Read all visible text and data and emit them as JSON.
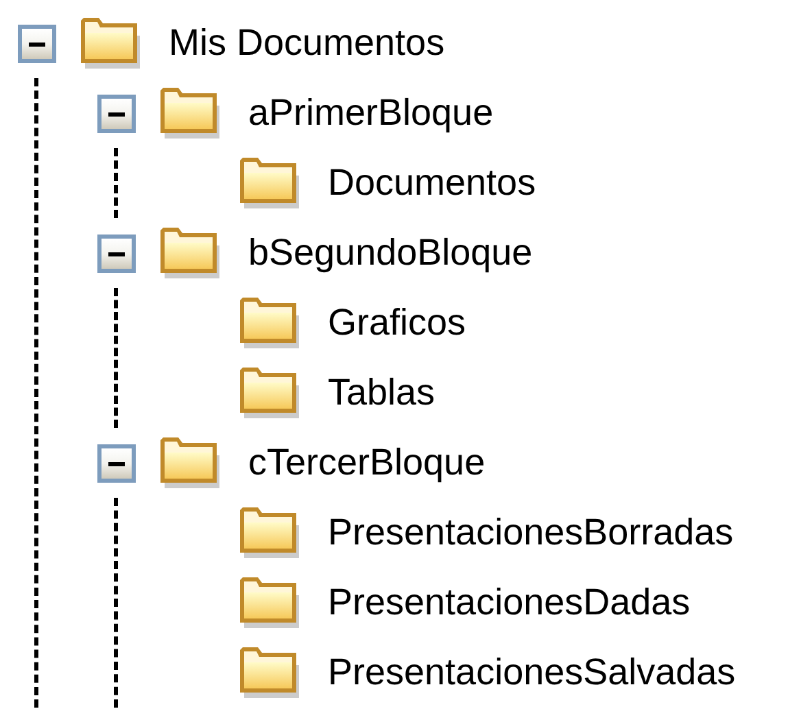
{
  "tree": [
    {
      "label": "Mis Documentos",
      "expanded": true,
      "children": [
        {
          "label": "aPrimerBloque",
          "expanded": true,
          "children": [
            {
              "label": "Documentos"
            }
          ]
        },
        {
          "label": "bSegundoBloque",
          "expanded": true,
          "children": [
            {
              "label": "Graficos"
            },
            {
              "label": "Tablas"
            }
          ]
        },
        {
          "label": "cTercerBloque",
          "expanded": true,
          "children": [
            {
              "label": "PresentacionesBorradas"
            },
            {
              "label": "PresentacionesDadas"
            },
            {
              "label": "PresentacionesSalvadas"
            }
          ]
        }
      ]
    }
  ]
}
